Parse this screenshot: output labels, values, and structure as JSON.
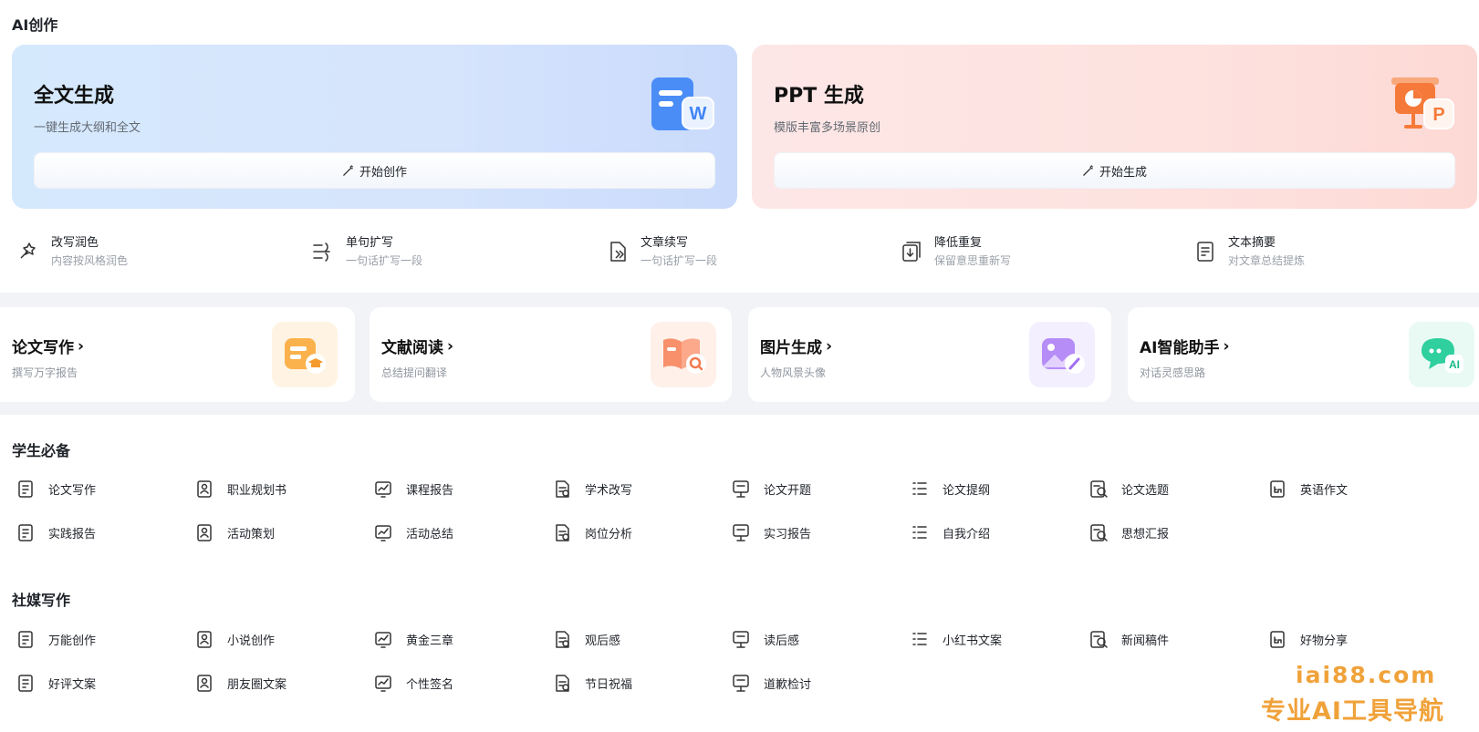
{
  "ai_section": {
    "title": "AI创作"
  },
  "hero_cards": [
    {
      "title": "全文生成",
      "subtitle": "一键生成大纲和全文",
      "button": "开始创作",
      "icon": "word-doc-icon"
    },
    {
      "title": "PPT 生成",
      "subtitle": "模版丰富多场景原创",
      "button": "开始生成",
      "icon": "ppt-icon"
    }
  ],
  "tools": [
    {
      "name": "改写润色",
      "desc": "内容按风格润色",
      "icon": "magic-pen-icon"
    },
    {
      "name": "单句扩写",
      "desc": "一句话扩写一段",
      "icon": "expand-lines-icon"
    },
    {
      "name": "文章续写",
      "desc": "一句话扩写一段",
      "icon": "document-forward-icon"
    },
    {
      "name": "降低重复",
      "desc": "保留意思重新写",
      "icon": "download-copy-icon"
    },
    {
      "name": "文本摘要",
      "desc": "对文章总结提炼",
      "icon": "summary-list-icon"
    }
  ],
  "feature_cards": [
    {
      "title": "论文写作",
      "subtitle": "撰写万字报告",
      "icon": "graduation-doc-icon"
    },
    {
      "title": "文献阅读",
      "subtitle": "总结提问翻译",
      "icon": "book-search-icon"
    },
    {
      "title": "图片生成",
      "subtitle": "人物风景头像",
      "icon": "image-brush-icon"
    },
    {
      "title": "AI智能助手",
      "subtitle": "对话灵感思路",
      "icon": "chat-ai-icon"
    }
  ],
  "student_section": {
    "title": "学生必备",
    "items": [
      {
        "label": "论文写作",
        "icon": "paper-icon"
      },
      {
        "label": "职业规划书",
        "icon": "career-plan-icon"
      },
      {
        "label": "课程报告",
        "icon": "course-report-icon"
      },
      {
        "label": "学术改写",
        "icon": "academic-rewrite-icon"
      },
      {
        "label": "论文开题",
        "icon": "thesis-proposal-icon"
      },
      {
        "label": "论文提纲",
        "icon": "outline-icon"
      },
      {
        "label": "论文选题",
        "icon": "topic-search-icon"
      },
      {
        "label": "英语作文",
        "icon": "english-essay-icon"
      },
      {
        "label": "实践报告",
        "icon": "practice-report-icon"
      },
      {
        "label": "活动策划",
        "icon": "megaphone-icon"
      },
      {
        "label": "活动总结",
        "icon": "balloon-icon"
      },
      {
        "label": "岗位分析",
        "icon": "job-analysis-icon"
      },
      {
        "label": "实习报告",
        "icon": "internship-icon"
      },
      {
        "label": "自我介绍",
        "icon": "self-intro-icon"
      },
      {
        "label": "思想汇报",
        "icon": "thought-report-icon"
      }
    ]
  },
  "social_section": {
    "title": "社媒写作",
    "items": [
      {
        "label": "万能创作",
        "icon": "tools-icon"
      },
      {
        "label": "小说创作",
        "icon": "novel-icon"
      },
      {
        "label": "黄金三章",
        "icon": "golden-chapter-icon"
      },
      {
        "label": "观后感",
        "icon": "glasses-icon"
      },
      {
        "label": "读后感",
        "icon": "open-book-icon"
      },
      {
        "label": "小红书文案",
        "icon": "xiaohongshu-icon"
      },
      {
        "label": "新闻稿件",
        "icon": "newspaper-icon"
      },
      {
        "label": "好物分享",
        "icon": "share-hand-icon"
      },
      {
        "label": "好评文案",
        "icon": "thumbs-up-icon"
      },
      {
        "label": "朋友圈文案",
        "icon": "aperture-icon"
      },
      {
        "label": "个性签名",
        "icon": "signature-icon"
      },
      {
        "label": "节日祝福",
        "icon": "flower-icon"
      },
      {
        "label": "道歉检讨",
        "icon": "apology-icon"
      }
    ]
  },
  "watermark": {
    "domain": "iai88.com",
    "slogan": "专业AI工具导航"
  },
  "colors": {
    "orange": "#f0a23a",
    "blue_card": "#d5e9fd",
    "pink_card": "#fde7e6"
  }
}
